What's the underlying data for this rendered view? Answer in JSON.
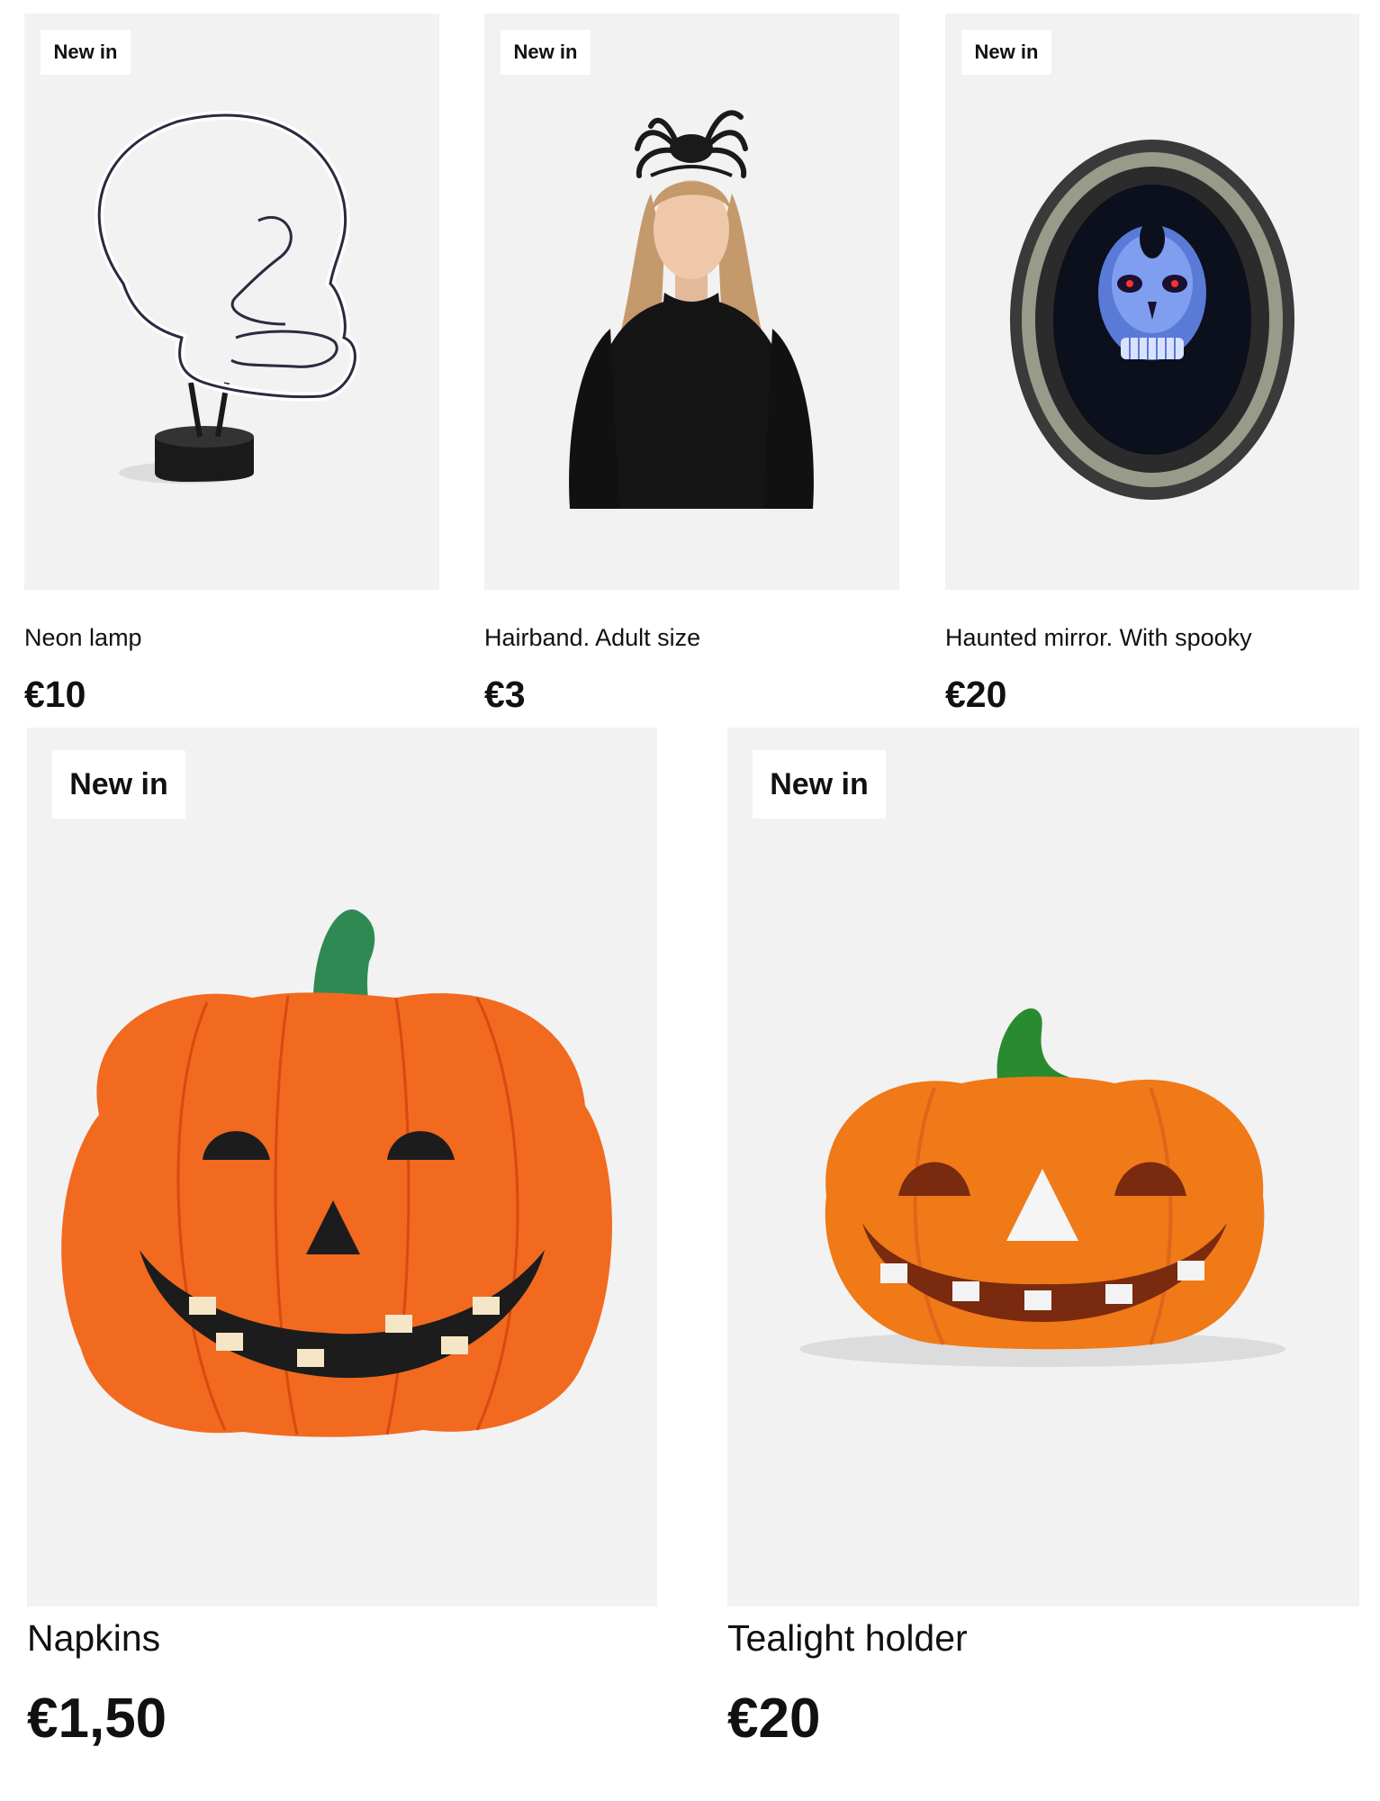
{
  "products": [
    {
      "badge": "New in",
      "title": "Neon lamp",
      "price": "€10",
      "image": "neon-skull-lamp"
    },
    {
      "badge": "New in",
      "title": "Hairband. Adult size",
      "price": "€3",
      "image": "spider-hairband-model"
    },
    {
      "badge": "New in",
      "title": "Haunted mirror. With spooky",
      "price": "€20",
      "image": "haunted-skull-mirror"
    },
    {
      "badge": "New in",
      "title": "Napkins",
      "price": "€1,50",
      "image": "pumpkin-napkin"
    },
    {
      "badge": "New in",
      "title": "Tealight holder",
      "price": "€20",
      "image": "pumpkin-tealight-holder"
    }
  ],
  "colors": {
    "card_background": "#f2f2f2",
    "pumpkin_orange": "#f26a1f",
    "stem_green": "#2e8a52"
  }
}
